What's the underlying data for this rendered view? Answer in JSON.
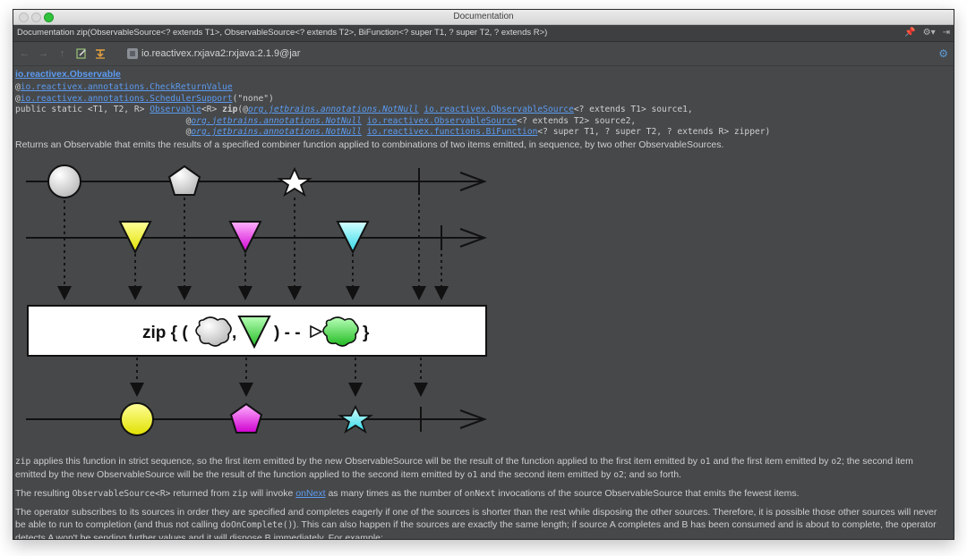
{
  "window": {
    "title": "Documentation"
  },
  "header": {
    "text": "Documentation zip(ObservableSource<? extends T1>, ObservableSource<? extends T2>, BiFunction<? super T1, ? super T2, ? extends R>)"
  },
  "toolbar": {
    "jar_label": "io.reactivex.rxjava2:rxjava:2.1.9@jar"
  },
  "doc": {
    "package_link": "io.reactivex.Observable",
    "annotation1": "io.reactivex.annotations.CheckReturnValue",
    "annotation2": "io.reactivex.annotations.SchedulerSupport",
    "annotation2_arg": "(\"none\")",
    "sig_prefix": "public static <T1, T2, R> ",
    "sig_return": "Observable",
    "sig_return_tail": "<R> ",
    "sig_method": "zip",
    "sig_open": "(@",
    "notnull": "org.jetbrains.annotations.NotNull",
    "obs_source": "io.reactivex.ObservableSource",
    "param1_tail": "<? extends T1> source1,",
    "param2_tail": "<? extends T2> source2,",
    "bifunction": "io.reactivex.functions.BiFunction",
    "param3_tail": "<? super T1, ? super T2, ? extends R> zipper)",
    "description": "Returns an Observable that emits the results of a specified combiner function applied to combinations of two items emitted, in sequence, by two other ObservableSources.",
    "diagram_label": "zip { (",
    "diagram_comma": ",",
    "diagram_tail": ") - -",
    "diagram_close": "}",
    "p1_code": "zip",
    "p1_text1": " applies this function in strict sequence, so the first item emitted by the new ObservableSource will be the result of the function applied to the first item emitted by ",
    "p1_o1a": "o1",
    "p1_text2": " and the first item emitted by ",
    "p1_o2a": "o2",
    "p1_text3": "; the second item emitted by the new ObservableSource will be the result of the function applied to the second item emitted by ",
    "p1_o1b": "o1",
    "p1_text4": " and the second item emitted by ",
    "p1_o2b": "o2",
    "p1_text5": "; and so forth.",
    "p2_text1": "The resulting ",
    "p2_code1": "ObservableSource<R>",
    "p2_text2": " returned from ",
    "p2_code2": "zip",
    "p2_text3": " will invoke ",
    "p2_link": "onNext",
    "p2_text4": " as many times as the number of ",
    "p2_code3": "onNext",
    "p2_text5": " invocations of the source ObservableSource that emits the fewest items.",
    "p3_text1": "The operator subscribes to its sources in order they are specified and completes eagerly if one of the sources is shorter than the rest while disposing the other sources. Therefore, it is possible those other sources will never be able to run to completion (and thus not calling ",
    "p3_code": "doOnComplete()",
    "p3_text2": "). This can also happen if the sources are exactly the same length; if source A completes and B has been consumed and is about to complete, the operator detects A won't be sending further values and it will dispose B immediately. For example:"
  }
}
